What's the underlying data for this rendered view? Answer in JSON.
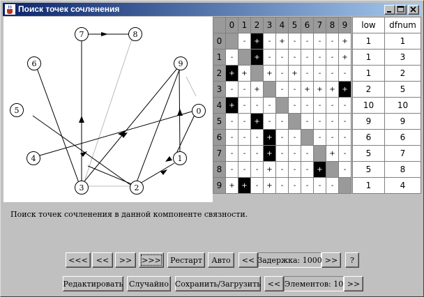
{
  "window": {
    "title": "Поиск точек сочленения"
  },
  "info_text": "Поиск точек сочленения в данной компоненте связности.",
  "graph": {
    "nodes": [
      "0",
      "1",
      "2",
      "3",
      "4",
      "5",
      "6",
      "7",
      "8",
      "9"
    ]
  },
  "matrix": {
    "headers": [
      "0",
      "1",
      "2",
      "3",
      "4",
      "5",
      "6",
      "7",
      "8",
      "9"
    ],
    "rows": [
      [
        "",
        "-",
        "+",
        "-",
        "+",
        "-",
        "-",
        "-",
        "-",
        "+"
      ],
      [
        "-",
        "",
        "+",
        "-",
        "-",
        "-",
        "-",
        "-",
        "-",
        "+"
      ],
      [
        "+",
        "+",
        "",
        "+",
        "-",
        "+",
        "-",
        "-",
        "-",
        "-"
      ],
      [
        "-",
        "-",
        "+",
        "",
        "-",
        "-",
        "+",
        "+",
        "+",
        "+"
      ],
      [
        "+",
        "-",
        "-",
        "-",
        "",
        "-",
        "-",
        "-",
        "-",
        "-"
      ],
      [
        "-",
        "-",
        "+",
        "-",
        "-",
        "",
        "-",
        "-",
        "-",
        "-"
      ],
      [
        "-",
        "-",
        "-",
        "+",
        "-",
        "-",
        "",
        "-",
        "-",
        "-"
      ],
      [
        "-",
        "-",
        "-",
        "+",
        "-",
        "-",
        "-",
        "",
        "+",
        "-"
      ],
      [
        "-",
        "-",
        "-",
        "+",
        "-",
        "-",
        "-",
        "+",
        "",
        "-"
      ],
      [
        "+",
        "+",
        "-",
        "+",
        "-",
        "-",
        "-",
        "-",
        "-",
        ""
      ]
    ],
    "black_cells": [
      [
        0,
        2
      ],
      [
        1,
        2
      ],
      [
        2,
        0
      ],
      [
        3,
        9
      ],
      [
        4,
        0
      ],
      [
        5,
        2
      ],
      [
        6,
        3
      ],
      [
        7,
        3
      ],
      [
        8,
        7
      ],
      [
        9,
        1
      ]
    ]
  },
  "lowtable": {
    "headers": [
      "low",
      "dfnum"
    ],
    "rows": [
      [
        "1",
        "1"
      ],
      [
        "1",
        "3"
      ],
      [
        "1",
        "2"
      ],
      [
        "2",
        "5"
      ],
      [
        "10",
        "10"
      ],
      [
        "9",
        "9"
      ],
      [
        "6",
        "6"
      ],
      [
        "5",
        "7"
      ],
      [
        "5",
        "8"
      ],
      [
        "1",
        "4"
      ]
    ]
  },
  "controls": {
    "first": "<<<",
    "prev": "<<",
    "next": ">>",
    "last": ">>>",
    "restart": "Рестарт",
    "auto": "Авто",
    "delay_dec": "<<",
    "delay_label": "Задержка: 1000",
    "delay_inc": ">>",
    "help": "?",
    "edit": "Редактировать",
    "random": "Случайно",
    "saveload": "Сохранить/Загрузить",
    "elems_dec": "<<",
    "elems_label": "Элементов: 10",
    "elems_inc": ">>"
  },
  "icons": {
    "app": "java-cup-icon",
    "minimize": "minimize-icon",
    "maximize": "maximize-icon",
    "close": "close-icon"
  }
}
